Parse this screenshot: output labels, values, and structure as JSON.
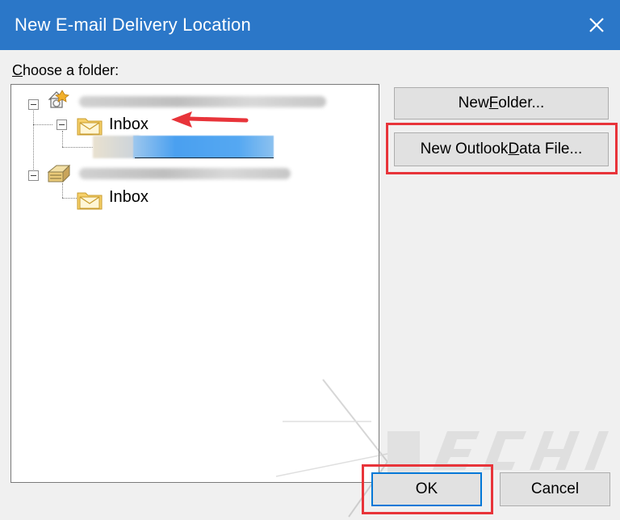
{
  "dialog": {
    "title": "New E-mail Delivery Location"
  },
  "chooser": {
    "label_accel": "C",
    "label_rest": "hoose a folder:"
  },
  "tree": {
    "account1": {
      "folder": "Inbox"
    },
    "account2": {
      "folder": "Inbox"
    }
  },
  "buttons": {
    "new_folder_pre": "New ",
    "new_folder_accel": "F",
    "new_folder_post": "older...",
    "new_data_file_pre": "New Outlook ",
    "new_data_file_accel": "D",
    "new_data_file_post": "ata File...",
    "ok": "OK",
    "cancel": "Cancel"
  },
  "colors": {
    "titlebar": "#2b77c8",
    "highlight": "#e8343a",
    "selection": "#4aa0f0"
  }
}
